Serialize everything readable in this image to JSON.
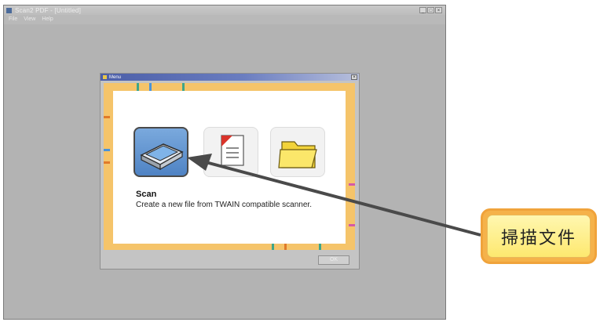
{
  "app": {
    "title": "Scan2 PDF - [Untitled]",
    "menu": [
      "File",
      "View",
      "Help"
    ],
    "controls": [
      "_",
      "□",
      "×"
    ]
  },
  "dialog": {
    "title": "Menu",
    "close": "×",
    "options": [
      {
        "name": "scan",
        "icon": "scanner-icon",
        "selected": true
      },
      {
        "name": "pdf",
        "icon": "pdf-document-icon",
        "selected": false
      },
      {
        "name": "folder",
        "icon": "folder-icon",
        "selected": false
      }
    ],
    "selected_title": "Scan",
    "selected_description": "Create a new file from TWAIN compatible scanner.",
    "ok_label": "OK"
  },
  "callout": {
    "label": "掃描文件"
  },
  "colors": {
    "frame_orange": "#f5c46a",
    "callout_fill": "#fde86f",
    "callout_border": "#f0a33b",
    "arrow": "#4a4a4a",
    "scan_tile": "#5a8fcf"
  }
}
